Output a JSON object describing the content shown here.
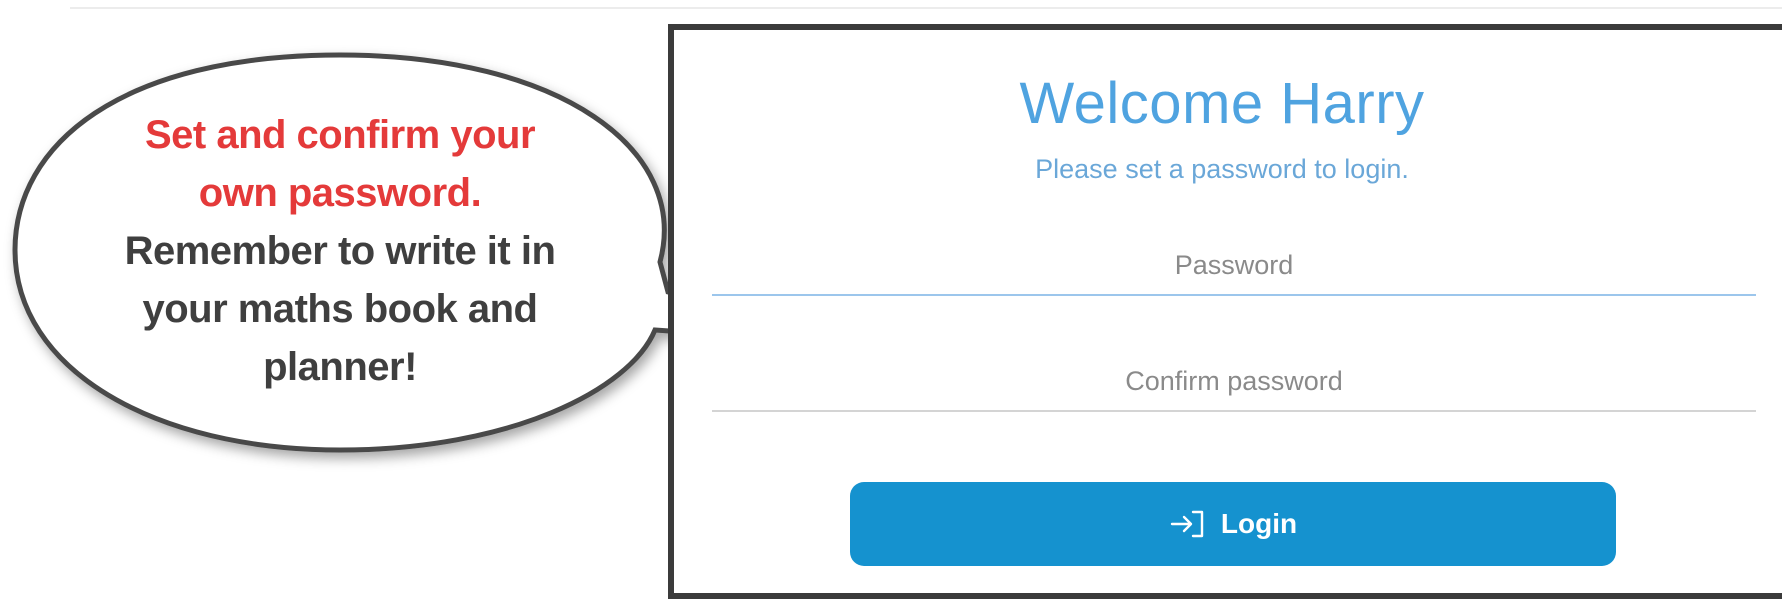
{
  "callout": {
    "line1": "Set and confirm your",
    "line2": "own password.",
    "line3": "Remember to write it in",
    "line4": "your maths book and",
    "line5": "planner!"
  },
  "login": {
    "title": "Welcome Harry",
    "subtitle": "Please set a password to login.",
    "password_placeholder": "Password",
    "confirm_placeholder": "Confirm password",
    "button_label": "Login",
    "button_icon": "login-arrow-icon"
  },
  "colors": {
    "title": "#4fa3e0",
    "button": "#1592cf",
    "callout_highlight": "#e43a3a",
    "callout_text": "#3f3f3f",
    "panel_border": "#3b3b3b"
  }
}
